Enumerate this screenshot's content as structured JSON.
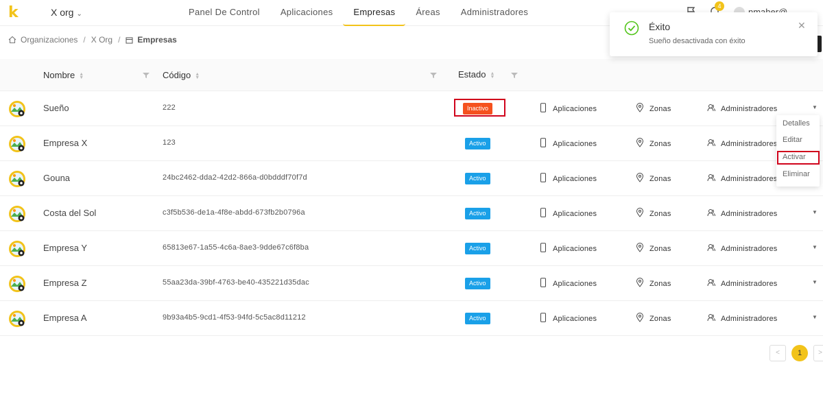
{
  "app": {
    "logo": "k",
    "org": "X org",
    "user": "nmaher@",
    "notifications": "4",
    "accent": "#f2c31a"
  },
  "nav": [
    "Panel De Control",
    "Aplicaciones",
    "Empresas",
    "Áreas",
    "Administradores"
  ],
  "nav_active": "Empresas",
  "breadcrumb": {
    "root": "Organizaciones",
    "org": "X Org",
    "current": "Empresas"
  },
  "toast": {
    "title": "Éxito",
    "message": "Sueño desactivada con éxito",
    "icon": "check-circle-icon",
    "color": "#52c41a"
  },
  "table": {
    "headers": {
      "name": "Nombre",
      "code": "Código",
      "status": "Estado"
    },
    "link_labels": {
      "apps": "Aplicaciones",
      "zones": "Zonas",
      "admins": "Administradores"
    },
    "rows": [
      {
        "name": "Sueño",
        "code": "222",
        "status": "Inactivo",
        "active": false
      },
      {
        "name": "Empresa X",
        "code": "123",
        "status": "Activo",
        "active": true
      },
      {
        "name": "Gouna",
        "code": "24bc2462-dda2-42d2-866a-d0bdddf70f7d",
        "status": "Activo",
        "active": true
      },
      {
        "name": "Costa del Sol",
        "code": "c3f5b536-de1a-4f8e-abdd-673fb2b0796a",
        "status": "Activo",
        "active": true
      },
      {
        "name": "Empresa Y",
        "code": "65813e67-1a55-4c6a-8ae3-9dde67c6f8ba",
        "status": "Activo",
        "active": true
      },
      {
        "name": "Empresa Z",
        "code": "55aa23da-39bf-4763-be40-435221d35dac",
        "status": "Activo",
        "active": true
      },
      {
        "name": "Empresa A",
        "code": "9b93a4b5-9cd1-4f53-94fd-5c5ac8d11212",
        "status": "Activo",
        "active": true
      }
    ]
  },
  "menu": {
    "details": "Detalles",
    "edit": "Editar",
    "activate": "Activar",
    "delete": "Eliminar"
  },
  "pagination": {
    "current": "1"
  }
}
